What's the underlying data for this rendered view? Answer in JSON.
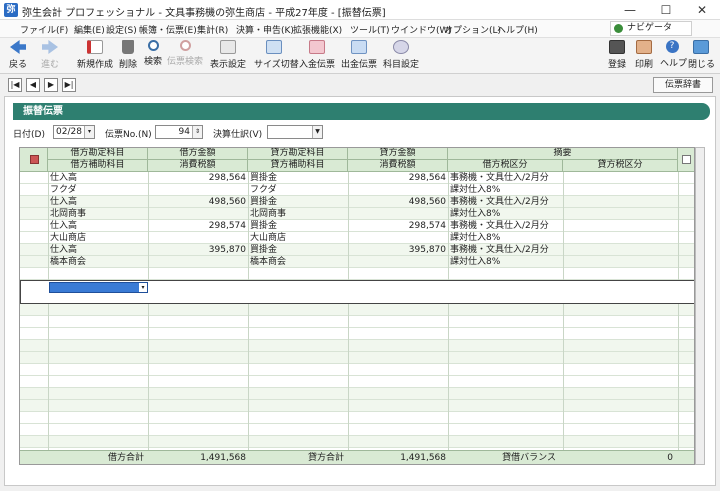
{
  "window": {
    "title": "弥生会計 プロフェッショナル - 文具事務機の弥生商店 - 平成27年度 - [振替伝票]",
    "minimize": "—",
    "maximize": "☐",
    "close": "✕"
  },
  "menu": {
    "items": [
      {
        "label": "ファイル(F)"
      },
      {
        "label": "編集(E)"
      },
      {
        "label": "設定(S)"
      },
      {
        "label": "帳簿・伝票(E)"
      },
      {
        "label": "集計(R)"
      },
      {
        "label": "決算・申告(K)"
      },
      {
        "label": "拡張機能(X)"
      },
      {
        "label": "ツール(T)"
      },
      {
        "label": "ウインドウ(W)"
      },
      {
        "label": "オプション(L)"
      },
      {
        "label": "ヘルプ(H)"
      }
    ],
    "navigator": "ナビゲータ"
  },
  "toolbar": {
    "back": "戻る",
    "forward": "進む",
    "new": "新規作成",
    "delete": "削除",
    "search": "検索",
    "sort": "伝票検索",
    "display_settings": "表示設定",
    "size_switch": "サイズ切替",
    "deposit": "入金伝票",
    "withdrawal": "出金伝票",
    "account_settings": "科目設定",
    "register": "登録",
    "print": "印刷",
    "help": "ヘルプ",
    "close": "閉じる"
  },
  "nav": {
    "first": "|◀",
    "prev": "◀",
    "next": "▶",
    "last": "▶|",
    "dictionary": "伝票辞書"
  },
  "form": {
    "title": "振替伝票",
    "date_label": "日付(D)",
    "date_value": "02/28",
    "voucher_no_label": "伝票No.(N)",
    "voucher_no_value": "94",
    "closing_label": "決算仕訳(V)",
    "closing_value": ""
  },
  "grid": {
    "headers_top": [
      "借方勘定科目",
      "借方金額",
      "貸方勘定科目",
      "貸方金額",
      "摘要"
    ],
    "headers_bottom": [
      "借方補助科目",
      "消費税額",
      "貸方補助科目",
      "消費税額",
      "借方税区分",
      "貸方税区分"
    ],
    "entries": [
      {
        "debit_account": "仕入高",
        "debit_sub": "フクダ",
        "debit_amount": "298,564",
        "credit_account": "買掛金",
        "credit_sub": "フクダ",
        "credit_amount": "298,564",
        "memo": "事務機・文具仕入/2月分",
        "debit_tax": "課対仕入8%"
      },
      {
        "debit_account": "仕入高",
        "debit_sub": "北岡商事",
        "debit_amount": "498,560",
        "credit_account": "買掛金",
        "credit_sub": "北岡商事",
        "credit_amount": "498,560",
        "memo": "事務機・文具仕入/2月分",
        "debit_tax": "課対仕入8%"
      },
      {
        "debit_account": "仕入高",
        "debit_sub": "大山商店",
        "debit_amount": "298,574",
        "credit_account": "買掛金",
        "credit_sub": "大山商店",
        "credit_amount": "298,574",
        "memo": "事務機・文具仕入/2月分",
        "debit_tax": "課対仕入8%"
      },
      {
        "debit_account": "仕入高",
        "debit_sub": "橋本商会",
        "debit_amount": "395,870",
        "credit_account": "買掛金",
        "credit_sub": "橋本商会",
        "credit_amount": "395,870",
        "memo": "事務機・文具仕入/2月分",
        "debit_tax": "課対仕入8%"
      }
    ],
    "totals": {
      "debit_label": "借方合計",
      "debit_total": "1,491,568",
      "credit_label": "貸方合計",
      "credit_total": "1,491,568",
      "balance_label": "貸借バランス",
      "balance_value": "0"
    }
  },
  "colors": {
    "accent": "#2e7f70",
    "grid_header": "#d9ead4",
    "grid_band": "#f1f7ee",
    "selected_cell": "#3a7bd5"
  }
}
